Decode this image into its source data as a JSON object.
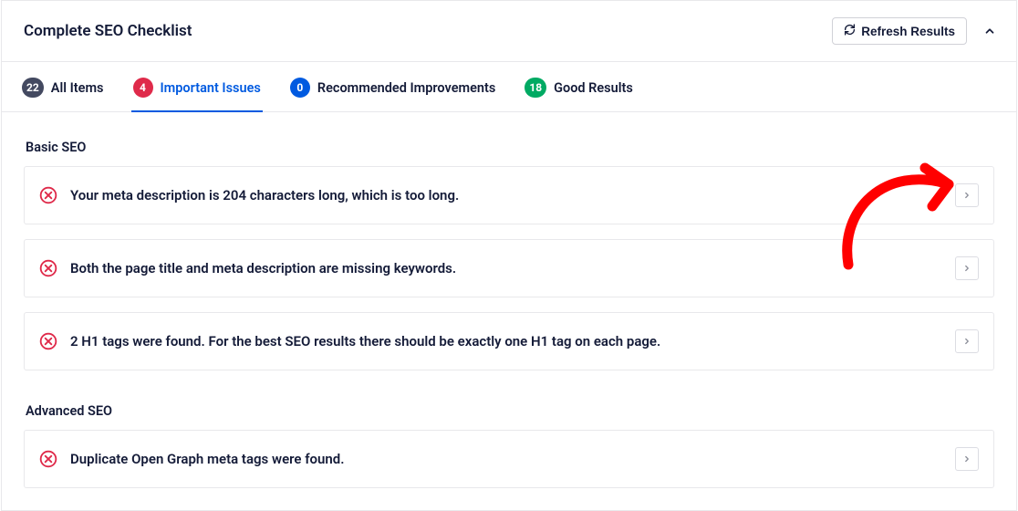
{
  "header": {
    "title": "Complete SEO Checklist",
    "refresh_label": "Refresh Results"
  },
  "tabs": {
    "all": {
      "count": "22",
      "label": "All Items"
    },
    "important": {
      "count": "4",
      "label": "Important Issues"
    },
    "recommended": {
      "count": "0",
      "label": "Recommended Improvements"
    },
    "good": {
      "count": "18",
      "label": "Good Results"
    }
  },
  "sections": {
    "basic": {
      "title": "Basic SEO"
    },
    "advanced": {
      "title": "Advanced SEO"
    }
  },
  "issues": {
    "basic": [
      {
        "text": "Your meta description is 204 characters long, which is too long."
      },
      {
        "text": "Both the page title and meta description are missing keywords."
      },
      {
        "text": "2 H1 tags were found. For the best SEO results there should be exactly one H1 tag on each page."
      }
    ],
    "advanced": [
      {
        "text": "Duplicate Open Graph meta tags were found."
      }
    ]
  }
}
